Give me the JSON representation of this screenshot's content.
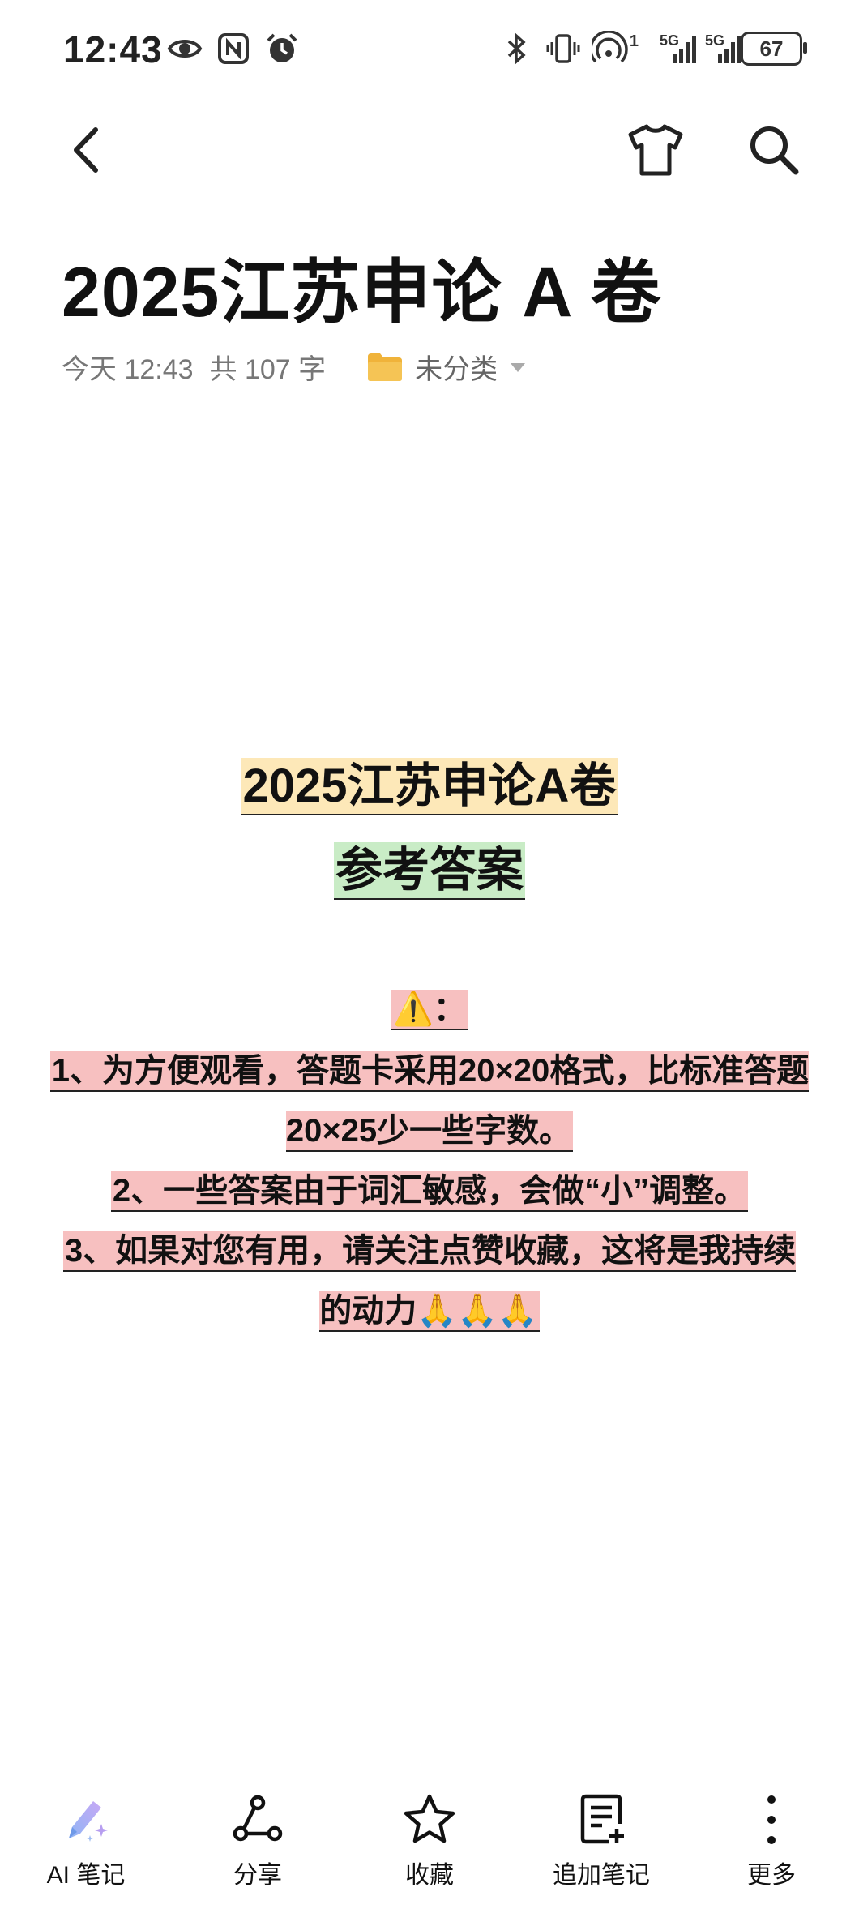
{
  "status_bar": {
    "time": "12:43",
    "signal_label_1": "5G",
    "signal_label_2": "5G",
    "sim_index": "1",
    "battery": "67"
  },
  "nav": {
    "back_icon": "chevron-left-icon",
    "theme_icon": "tshirt-icon",
    "search_icon": "search-icon"
  },
  "note": {
    "title": "2025江苏申论 A 卷",
    "date": "今天 12:43",
    "word_count": "共 107 字",
    "folder": "未分类"
  },
  "content": {
    "heading": "2025江苏申论A卷",
    "subheading": "参考答案",
    "warning_line": "⚠️：",
    "line1": "1、为方便观看，答题卡采用20×20格式，比标准答题20×25少一些字数。",
    "line2": "2、一些答案由于词汇敏感，会做“小”调整。",
    "line3": "3、如果对您有用，请关注点赞收藏，这将是我持续的动力🙏🙏🙏"
  },
  "toolbar": {
    "ai_note": "AI 笔记",
    "share": "分享",
    "favorite": "收藏",
    "append_note": "追加笔记",
    "more": "更多"
  },
  "colors": {
    "highlight_yellow": "#fde8b8",
    "highlight_green": "#c9ecc6",
    "highlight_pink": "#f7c0c0",
    "folder": "#f0b33a"
  }
}
